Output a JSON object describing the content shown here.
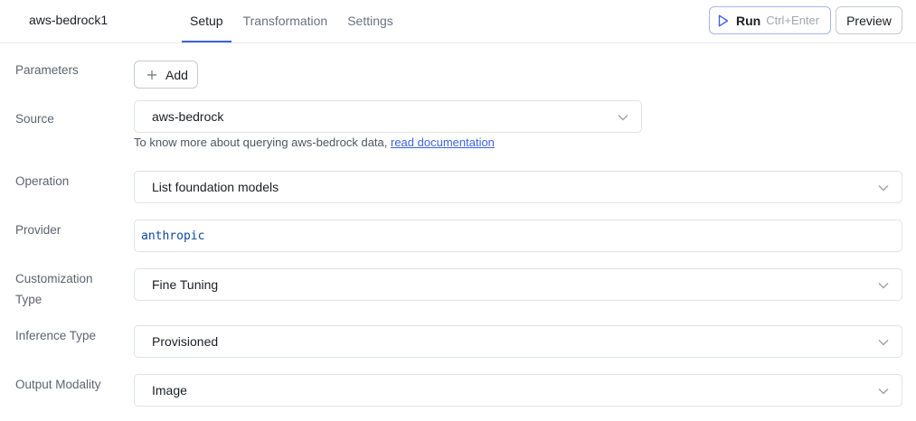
{
  "header": {
    "query_name": "aws-bedrock1",
    "tabs": [
      {
        "label": "Setup",
        "active": true
      },
      {
        "label": "Transformation",
        "active": false
      },
      {
        "label": "Settings",
        "active": false
      }
    ],
    "run_label": "Run",
    "run_shortcut": "Ctrl+Enter",
    "preview_label": "Preview"
  },
  "form": {
    "parameters": {
      "label": "Parameters",
      "add_label": "Add"
    },
    "source": {
      "label": "Source",
      "value": "aws-bedrock",
      "help_text": "To know more about querying aws-bedrock data, ",
      "help_link": "read documentation"
    },
    "operation": {
      "label": "Operation",
      "value": "List foundation models"
    },
    "provider": {
      "label": "Provider",
      "value": "anthropic"
    },
    "customization_type": {
      "label_line1": "Customization",
      "label_line2": "Type",
      "value": "Fine Tuning"
    },
    "inference_type": {
      "label": "Inference Type",
      "value": "Provisioned"
    },
    "output_modality": {
      "label": "Output Modality",
      "value": "Image"
    }
  },
  "icons": {
    "run": "play-icon",
    "add": "plus-icon",
    "dropdown": "chevron-down-icon"
  },
  "colors": {
    "accent": "#3e63dd",
    "code_text": "#0d47a1",
    "border": "#dfe2e6"
  }
}
